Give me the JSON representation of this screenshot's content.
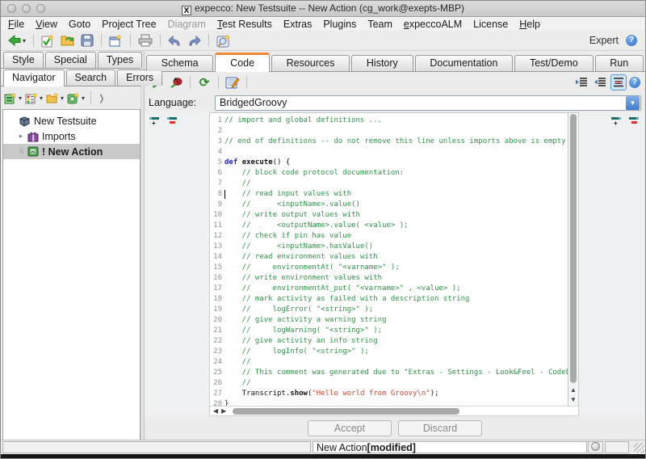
{
  "window": {
    "title": "expecco: New Testsuite -- New Action (cg_work@exepts-MBP)"
  },
  "menu_bar": {
    "items": [
      {
        "label": "File",
        "u": 0
      },
      {
        "label": "View",
        "u": 0
      },
      {
        "label": "Goto",
        "u": -1
      },
      {
        "label": "Project Tree",
        "u": -1
      },
      {
        "label": "Diagram",
        "u": -1,
        "disabled": true
      },
      {
        "label": "Test Results",
        "u": 0
      },
      {
        "label": "Extras",
        "u": -1
      },
      {
        "label": "Plugins",
        "u": -1
      },
      {
        "label": "Team",
        "u": -1
      },
      {
        "label": "expeccoALM",
        "u": 0
      },
      {
        "label": "License",
        "u": -1
      },
      {
        "label": "Help",
        "u": 0
      }
    ]
  },
  "toolbar": {
    "expert_label": "Expert",
    "buttons": [
      "back-arrow-icon",
      "accept-check-icon",
      "open-folder-icon",
      "save-icon",
      "new-window-icon",
      "print-icon",
      "undo-icon",
      "redo-icon",
      "browse-window-icon"
    ],
    "colors": {
      "back_green": "#3aaa3a",
      "undo_blue": "#8094cc",
      "folder_yellow": "#f2c24e"
    }
  },
  "left_panel": {
    "tab_row1": [
      "Style",
      "Special",
      "Types"
    ],
    "tab_row2": [
      "Navigator",
      "Search",
      "Errors"
    ],
    "active_tab": "Navigator",
    "new_buttons": [
      "new-testsuite-icon",
      "new-testplan-icon",
      "new-group-icon",
      "new-action-icon"
    ],
    "tree": [
      {
        "label": "New Testsuite",
        "icon": "testsuite-icon",
        "level": 0,
        "selected": false
      },
      {
        "label": "Imports",
        "icon": "imports-icon",
        "level": 1,
        "expander": true,
        "selected": false
      },
      {
        "label": "! New Action",
        "icon": "action-icon",
        "level": 1,
        "selected": true
      }
    ]
  },
  "right_panel": {
    "tabs": [
      "Schema",
      "Code",
      "Resources",
      "History",
      "Documentation",
      "Test/Demo",
      "Run"
    ],
    "active_tab": "Code",
    "active_tab_accent": "#ee8833",
    "language_label": "Language:",
    "language_value": "BridgedGroovy",
    "accept_label": "Accept",
    "discard_label": "Discard"
  },
  "editor": {
    "cursor_line": 8,
    "syntax_colors": {
      "comment": "#2e9148",
      "keyword": "#1f1fd0",
      "string": "#cc4433"
    },
    "lines": [
      {
        "no": 1,
        "tokens": [
          [
            "c",
            "// import and global definitions ..."
          ]
        ]
      },
      {
        "no": 2,
        "tokens": []
      },
      {
        "no": 3,
        "tokens": [
          [
            "c",
            "// end of definitions -- do not remove this line unless imports above is empty"
          ]
        ]
      },
      {
        "no": 4,
        "tokens": []
      },
      {
        "no": 5,
        "tokens": [
          [
            "k",
            "def"
          ],
          [
            "p",
            " "
          ],
          [
            "b",
            "execute"
          ],
          [
            "p",
            "() {"
          ]
        ]
      },
      {
        "no": 6,
        "tokens": [
          [
            "c",
            "    // block code protocol documentation:"
          ]
        ]
      },
      {
        "no": 7,
        "tokens": [
          [
            "c",
            "    //"
          ]
        ]
      },
      {
        "no": 8,
        "tokens": [
          [
            "c",
            "    // read input values with"
          ]
        ]
      },
      {
        "no": 9,
        "tokens": [
          [
            "c",
            "    //      <inputName>.value()"
          ]
        ]
      },
      {
        "no": 10,
        "tokens": [
          [
            "c",
            "    // write output values with"
          ]
        ]
      },
      {
        "no": 11,
        "tokens": [
          [
            "c",
            "    //      <outputName>.value( <value> );"
          ]
        ]
      },
      {
        "no": 12,
        "tokens": [
          [
            "c",
            "    // check if pin has value"
          ]
        ]
      },
      {
        "no": 13,
        "tokens": [
          [
            "c",
            "    //      <inputName>.hasValue()"
          ]
        ]
      },
      {
        "no": 14,
        "tokens": [
          [
            "c",
            "    // read environment values with"
          ]
        ]
      },
      {
        "no": 15,
        "tokens": [
          [
            "c",
            "    //     environmentAt( \"<varname>\" );"
          ]
        ]
      },
      {
        "no": 16,
        "tokens": [
          [
            "c",
            "    // write environment values with"
          ]
        ]
      },
      {
        "no": 17,
        "tokens": [
          [
            "c",
            "    //     environmentAt_put( \"<varname>\" , <value> );"
          ]
        ]
      },
      {
        "no": 18,
        "tokens": [
          [
            "c",
            "    // mark activity as failed with a description string"
          ]
        ]
      },
      {
        "no": 19,
        "tokens": [
          [
            "c",
            "    //     logError( \"<string>\" );"
          ]
        ]
      },
      {
        "no": 20,
        "tokens": [
          [
            "c",
            "    // give activity a warning string"
          ]
        ]
      },
      {
        "no": 21,
        "tokens": [
          [
            "c",
            "    //     logWarning( \"<string>\" );"
          ]
        ]
      },
      {
        "no": 22,
        "tokens": [
          [
            "c",
            "    // give activity an info string"
          ]
        ]
      },
      {
        "no": 23,
        "tokens": [
          [
            "c",
            "    //     logInfo( \"<string>\" );"
          ]
        ]
      },
      {
        "no": 24,
        "tokens": [
          [
            "c",
            "    //"
          ]
        ]
      },
      {
        "no": 25,
        "tokens": [
          [
            "c",
            "    // This comment was generated due to \"Extras - Settings - Look&Feel - CodeEditor - "
          ]
        ]
      },
      {
        "no": 26,
        "tokens": [
          [
            "c",
            "    //"
          ]
        ]
      },
      {
        "no": 27,
        "tokens": [
          [
            "p",
            "    Transcript."
          ],
          [
            "b",
            "show"
          ],
          [
            "p",
            "("
          ],
          [
            "s",
            "\"Hello world from Groovy\\n\""
          ],
          [
            "p",
            ");"
          ]
        ]
      },
      {
        "no": 28,
        "tokens": [
          [
            "p",
            "}"
          ]
        ]
      }
    ]
  },
  "status_bar": {
    "item_name": "New Action ",
    "item_state": "[modified]"
  }
}
